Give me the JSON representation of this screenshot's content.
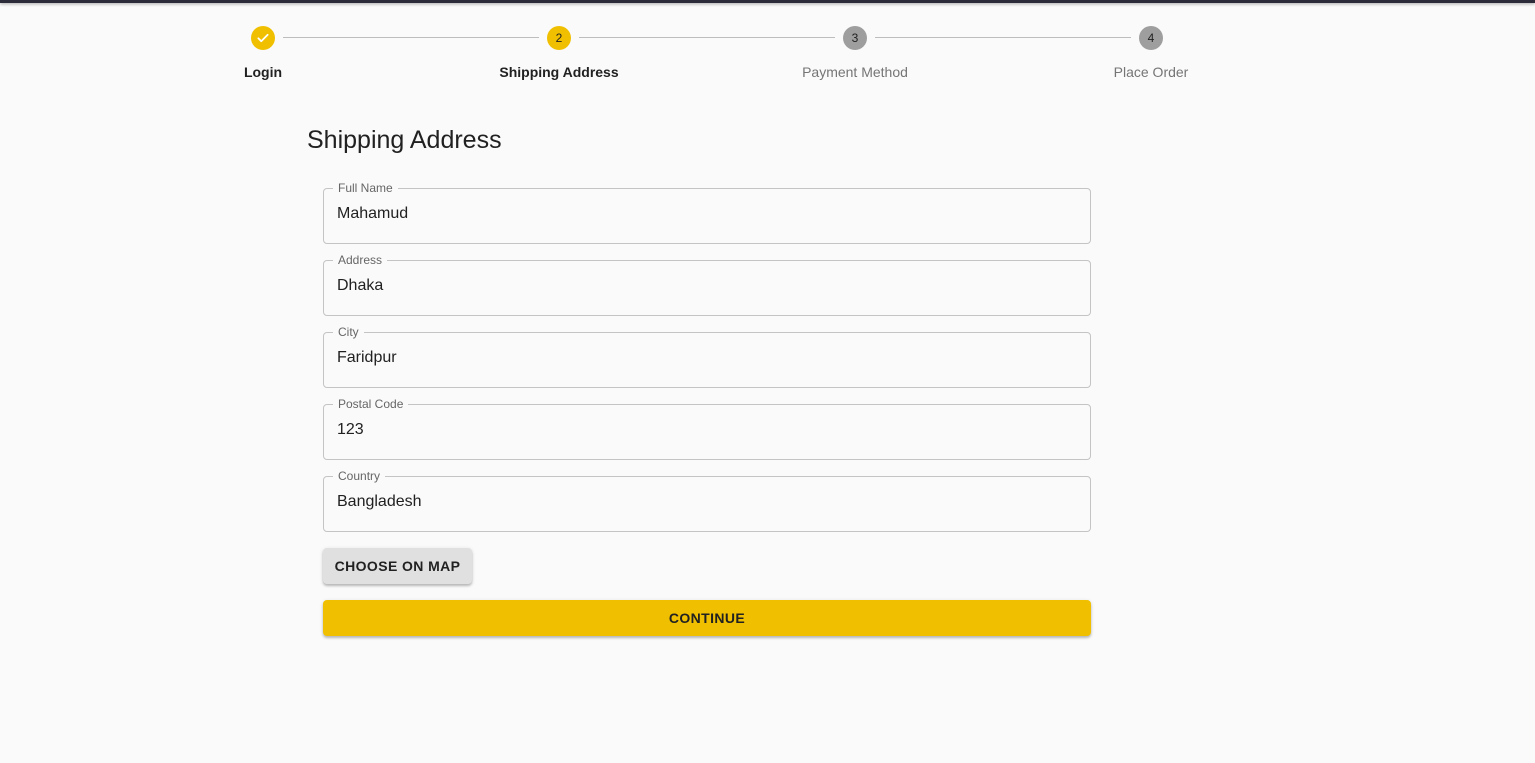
{
  "stepper": {
    "steps": [
      {
        "label": "Login",
        "number": "",
        "status": "completed",
        "icon": "check-icon"
      },
      {
        "label": "Shipping Address",
        "number": "2",
        "status": "active"
      },
      {
        "label": "Payment Method",
        "number": "3",
        "status": "pending"
      },
      {
        "label": "Place Order",
        "number": "4",
        "status": "pending"
      }
    ]
  },
  "form": {
    "title": "Shipping Address",
    "fields": [
      {
        "label": "Full Name",
        "value": "Mahamud"
      },
      {
        "label": "Address",
        "value": "Dhaka"
      },
      {
        "label": "City",
        "value": "Faridpur"
      },
      {
        "label": "Postal Code",
        "value": "123"
      },
      {
        "label": "Country",
        "value": "Bangladesh"
      }
    ],
    "choose_on_map_label": "CHOOSE ON MAP",
    "continue_label": "CONTINUE"
  },
  "colors": {
    "accent": "#f0c000",
    "pending_step": "#9e9e9e",
    "background": "#fafafa"
  }
}
